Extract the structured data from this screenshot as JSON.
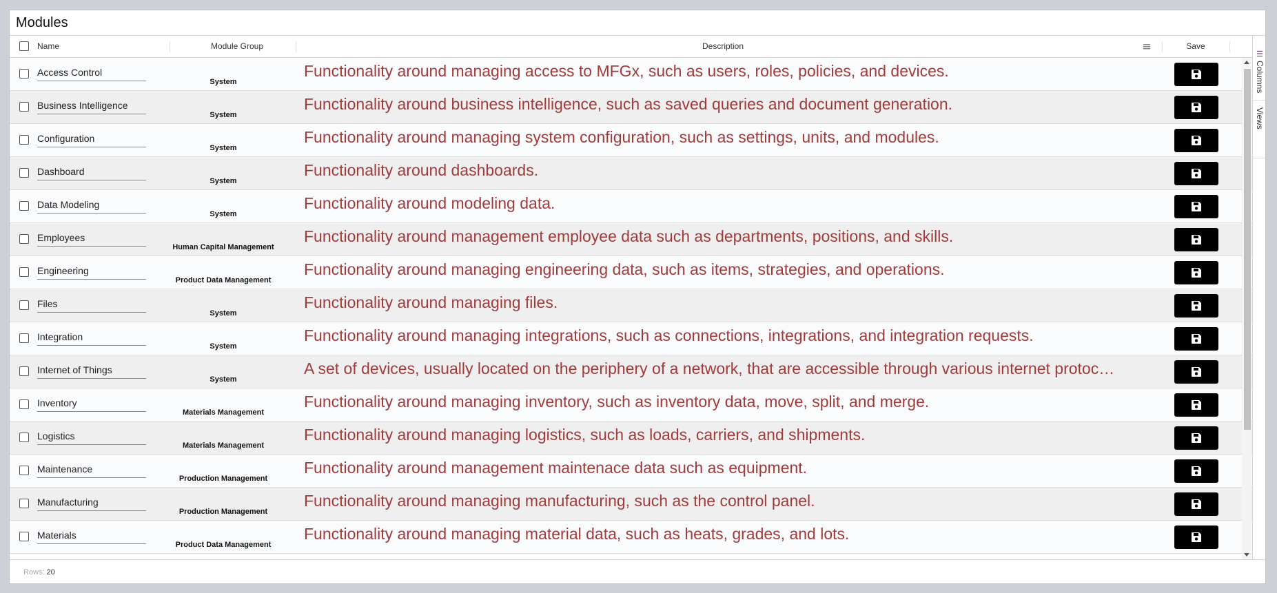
{
  "title": "Modules",
  "header": {
    "name": "Name",
    "group": "Module Group",
    "description": "Description",
    "save": "Save"
  },
  "sidebar": {
    "columns": "Columns",
    "views": "Views"
  },
  "footer": {
    "rows_label": "Rows:",
    "rows_value": "20"
  },
  "rows": [
    {
      "name": "Access Control",
      "group": "System",
      "description": "Functionality around managing access to MFGx, such as users, roles, policies, and devices."
    },
    {
      "name": "Business Intelligence",
      "group": "System",
      "description": "Functionality around business intelligence, such as saved queries and document generation."
    },
    {
      "name": "Configuration",
      "group": "System",
      "description": "Functionality around managing system configuration, such as settings, units, and modules."
    },
    {
      "name": "Dashboard",
      "group": "System",
      "description": "Functionality around dashboards."
    },
    {
      "name": "Data Modeling",
      "group": "System",
      "description": "Functionality around modeling data."
    },
    {
      "name": "Employees",
      "group": "Human Capital Management",
      "description": "Functionality around management employee data such as departments, positions, and skills."
    },
    {
      "name": "Engineering",
      "group": "Product Data Management",
      "description": "Functionality around managing engineering data, such as items, strategies, and operations."
    },
    {
      "name": "Files",
      "group": "System",
      "description": "Functionality around managing files."
    },
    {
      "name": "Integration",
      "group": "System",
      "description": "Functionality around managing integrations, such as connections, integrations, and integration requests."
    },
    {
      "name": "Internet of Things",
      "group": "System",
      "description": "A set of devices, usually located on the periphery of a network, that are accessible through various internet protoc…"
    },
    {
      "name": "Inventory",
      "group": "Materials Management",
      "description": "Functionality around managing inventory, such as inventory data, move, split, and merge."
    },
    {
      "name": "Logistics",
      "group": "Materials Management",
      "description": "Functionality around managing logistics, such as loads, carriers, and shipments."
    },
    {
      "name": "Maintenance",
      "group": "Production Management",
      "description": "Functionality around management maintenace data such as equipment."
    },
    {
      "name": "Manufacturing",
      "group": "Production Management",
      "description": "Functionality around managing manufacturing, such as the control panel."
    },
    {
      "name": "Materials",
      "group": "Product Data Management",
      "description": "Functionality around managing material data, such as heats, grades, and lots."
    }
  ],
  "colors": {
    "description_text": "#a33a3a",
    "save_button": "#000000"
  },
  "icons": {
    "save": "floppy-disk-icon",
    "menu": "hamburger-menu-icon",
    "columns": "columns-icon"
  }
}
